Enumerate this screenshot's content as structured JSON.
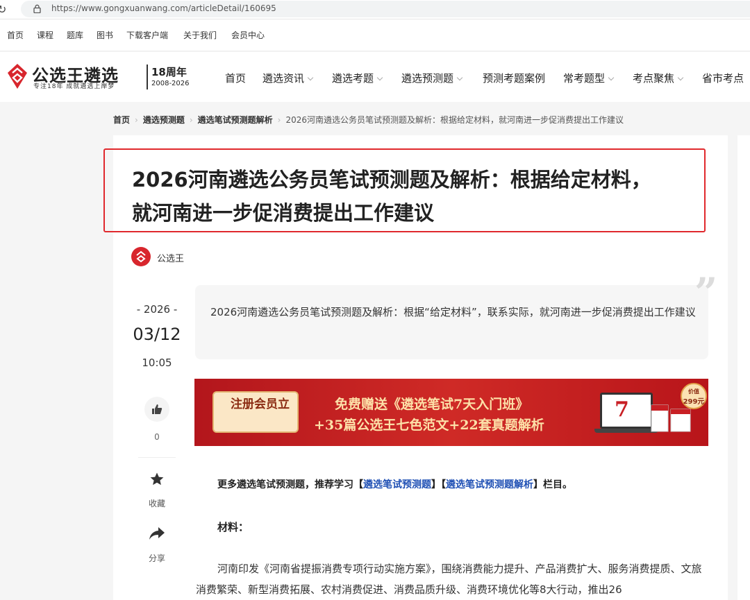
{
  "browser": {
    "url": "https://www.gongxuanwang.com/articleDetail/160695"
  },
  "topnav": [
    "首页",
    "课程",
    "题库",
    "图书",
    "下载客户端",
    "关于我们",
    "会员中心"
  ],
  "header": {
    "logo_text": "公选王遴选",
    "logo_slogan": "专注18年  成就遴选上岸梦",
    "anniversary": "18周年",
    "anniversary_years": "2008-2026"
  },
  "mainnav": [
    "首页",
    "遴选资讯",
    "遴选考题",
    "遴选预测题",
    "预测考题案例",
    "常考题型",
    "考点聚焦",
    "省市考点"
  ],
  "breadcrumb": {
    "items": [
      "首页",
      "遴选预测题",
      "遴选笔试预测题解析"
    ],
    "current": "2026河南遴选公务员笔试预测题及解析：根据给定材料，就河南进一步促消费提出工作建议"
  },
  "article": {
    "title_line1": "2026河南遴选公务员笔试预测题及解析：根据给定材料，",
    "title_line2": "就河南进一步促消费提出工作建议",
    "author": "公选王",
    "date_year": "2026",
    "date_md": "03/12",
    "date_time": "10:05",
    "summary": "2026河南遴选公务员笔试预测题及解析：根据“给定材料”，联系实际，就河南进一步促消费提出工作建议",
    "likes": "0",
    "fav_label": "收藏",
    "share_label": "分享"
  },
  "banner": {
    "button": "注册会员立",
    "line1": "免费赠送《遴选笔试7天入门班》",
    "line2": "+35篇公选王七色范文+22套真题解析",
    "seven": "7",
    "price_label": "价值",
    "price": "299元"
  },
  "body": {
    "pre": "更多遴选笔试预测题，推荐学习【",
    "link1": "遴选笔试预测题",
    "mid": "】【",
    "link2": "遴选笔试预测题解析",
    "post": "】栏目。",
    "material": "材料：",
    "para": "河南印发《河南省提振消费专项行动实施方案》，围绕消费能力提升、产品消费扩大、服务消费提质、文旅消费繁荣、新型消费拓展、农村消费促进、消费品质升级、消费环境优化等8大行动，推出26"
  },
  "colors": {
    "brand_red": "#d8262d",
    "highlight_border": "#e0282c",
    "link_blue": "#1e4fb4"
  }
}
